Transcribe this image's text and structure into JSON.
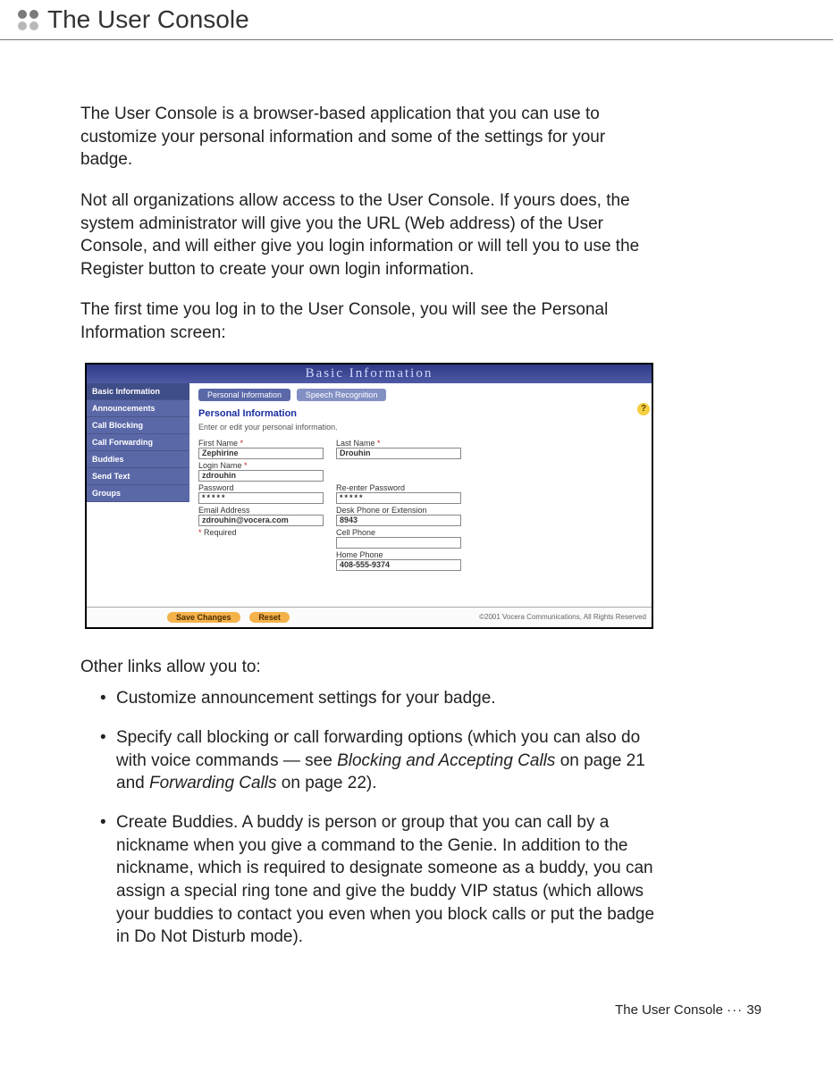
{
  "header": {
    "title": "The User Console"
  },
  "paragraphs": {
    "p1": "The User Console is a browser-based application that you can use to customize your personal information and some of the settings for your badge.",
    "p2": "Not all organizations allow access to the User Console. If yours does, the system administrator will give you the URL (Web address) of the User Console, and will either give you login information or will tell you to use the Register button to create your own login information.",
    "p3": "The first time you log in to the User Console, you will see the Personal Information screen:"
  },
  "screenshot": {
    "window_title": "Basic Information",
    "sidebar": [
      "Basic Information",
      "Announcements",
      "Call Blocking",
      "Call Forwarding",
      "Buddies",
      "Send Text",
      "Groups"
    ],
    "tabs": {
      "active": "Personal Information",
      "other": "Speech Recognition"
    },
    "help": "?",
    "panel_title": "Personal Information",
    "panel_sub": "Enter or edit your personal information.",
    "fields": {
      "first_name": {
        "label": "First Name",
        "required": true,
        "value": "Zephirine"
      },
      "last_name": {
        "label": "Last Name",
        "required": true,
        "value": "Drouhin"
      },
      "login": {
        "label": "Login Name",
        "required": true,
        "value": "zdrouhin"
      },
      "password": {
        "label": "Password",
        "value": "*****"
      },
      "password2": {
        "label": "Re-enter Password",
        "value": "*****"
      },
      "email": {
        "label": "Email Address",
        "value": "zdrouhin@vocera.com"
      },
      "desk": {
        "label": "Desk Phone or Extension",
        "value": "8943"
      },
      "cell": {
        "label": "Cell Phone",
        "value": ""
      },
      "home": {
        "label": "Home Phone",
        "value": "408-555-9374"
      }
    },
    "required_note": "Required",
    "buttons": {
      "save": "Save Changes",
      "reset": "Reset"
    },
    "copyright": "©2001 Vocera Communications, All Rights Reserved"
  },
  "after": {
    "lead": "Other links allow you to:",
    "bullets": {
      "b1": "Customize announcement settings for your badge.",
      "b2a": "Specify call blocking or call forwarding options (which you can also do with voice commands — see ",
      "b2i1": "Blocking and Accepting Calls",
      "b2b": " on page 21 and ",
      "b2i2": "Forwarding Calls",
      "b2c": " on page 22).",
      "b3": "Create Buddies. A buddy is person or group that you can call by a nickname when you give a command to the Genie. In addition to the nickname, which is required to designate someone as a buddy, you can assign a special ring tone and give the buddy VIP status (which allows your buddies to contact you even when you block calls or put the badge in Do Not Disturb mode)."
    }
  },
  "footer": {
    "label": "The User Console",
    "sep": "···",
    "page": "39"
  }
}
